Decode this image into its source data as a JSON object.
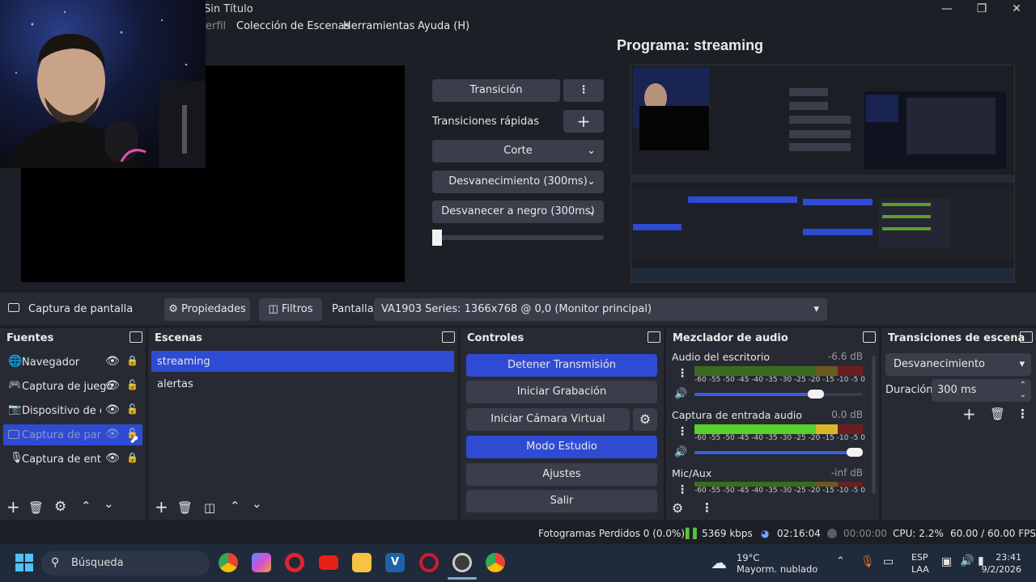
{
  "window": {
    "title": "Sin Título"
  },
  "menu": {
    "profile_partial": "erfil",
    "scene_collection": "Colección de Escenas",
    "tools": "Herramientas",
    "help": "Ayuda (H)"
  },
  "program": {
    "label": "Programa: streaming"
  },
  "transitions_panel": {
    "transition": "Transición",
    "quick_transitions": "Transiciones rápidas",
    "cut": "Corte",
    "fade": "Desvanecimiento (300ms)",
    "fade_black": "Desvanecer a negro (300ms)"
  },
  "source_toolbar": {
    "source_name": "Captura de pantalla",
    "properties": "Propiedades",
    "filters": "Filtros",
    "display_label": "Pantalla",
    "display_value": "VA1903 Series: 1366x768 @ 0,0 (Monitor principal)"
  },
  "sources": {
    "title": "Fuentes",
    "items": [
      {
        "label": "Navegador",
        "icon": "globe-icon",
        "visible": true,
        "locked": true
      },
      {
        "label": "Captura de juego",
        "icon": "gamepad-icon",
        "visible": true,
        "locked": false
      },
      {
        "label": "Dispositivo de cap",
        "icon": "camera-icon",
        "visible": true,
        "locked": false
      },
      {
        "label": "Captura de panta",
        "icon": "monitor-icon",
        "visible": false,
        "locked": false,
        "selected": true
      },
      {
        "label": "Captura de entra",
        "icon": "microphone-icon",
        "visible": true,
        "locked": true
      }
    ]
  },
  "scenes": {
    "title": "Escenas",
    "items": [
      "streaming",
      "alertas"
    ],
    "selected": "streaming"
  },
  "controls": {
    "title": "Controles",
    "stop_stream": "Detener Transmisión",
    "start_recording": "Iniciar Grabación",
    "start_virtual_cam": "Iniciar Cámara Virtual",
    "studio_mode": "Modo Estudio",
    "settings": "Ajustes",
    "exit": "Salir"
  },
  "mixer": {
    "title": "Mezclador de audio",
    "channels": [
      {
        "name": "Audio del escritorio",
        "db": "-6.6 dB",
        "volume": 0.72
      },
      {
        "name": "Captura de entrada audio",
        "db": "0.0 dB",
        "volume": 0.95
      },
      {
        "name": "Mic/Aux",
        "db": "-inf dB"
      }
    ],
    "ticks": [
      "-60",
      "-55",
      "-50",
      "-45",
      "-40",
      "-35",
      "-30",
      "-25",
      "-20",
      "-15",
      "-10",
      "-5",
      "0"
    ]
  },
  "scene_transitions": {
    "title": "Transiciones de escena",
    "selected": "Desvanecimiento",
    "duration_label": "Duración",
    "duration_value": "300 ms"
  },
  "status": {
    "dropped_frames": "Fotogramas Perdidos 0 (0.0%)",
    "bitrate": "5369 kbps",
    "stream_time": "02:16:04",
    "rec_time": "00:00:00",
    "cpu": "CPU: 2.2%",
    "fps": "60.00 / 60.00 FPS"
  },
  "taskbar": {
    "search_placeholder": "Búsqueda",
    "weather_temp": "19°C",
    "weather_desc": "Mayorm. nublado",
    "lang_top": "ESP",
    "lang_bottom": "LAA",
    "time": "23:41",
    "date": "9/2/2026"
  },
  "colors": {
    "accent": "#2f4bd4",
    "panel": "#272a33",
    "button": "#3a3d4a",
    "background": "#1d1f26"
  }
}
